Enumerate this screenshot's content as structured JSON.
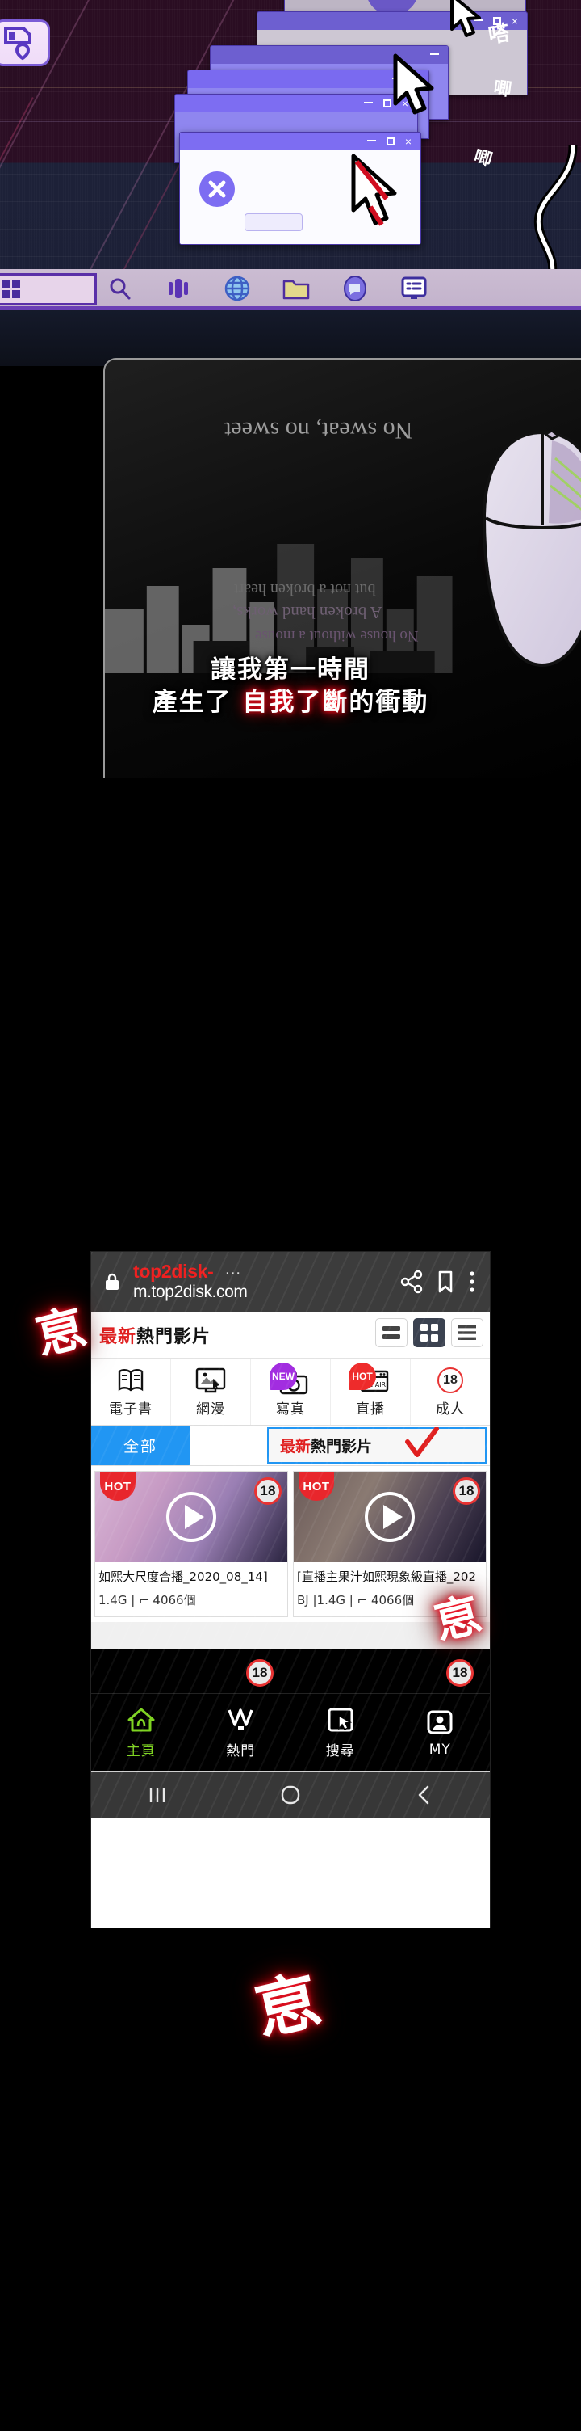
{
  "desktop": {
    "dialogs": [
      {
        "name": "dialog-1",
        "min": "—",
        "max": "□",
        "close": "×"
      },
      {
        "name": "dialog-2",
        "min": "—",
        "max": "□",
        "close": "×"
      },
      {
        "name": "dialog-3",
        "min": "—",
        "max": "□",
        "close": "×"
      },
      {
        "name": "dialog-4",
        "min": "—",
        "max": "□",
        "close": "×"
      },
      {
        "name": "dialog-5",
        "min": "—",
        "max": "□",
        "close": "×"
      }
    ],
    "error_dialog": {
      "icon": "error-x-icon",
      "minimize": "—",
      "maximize": "□",
      "close": "×",
      "button_label": ""
    },
    "taskbar": {
      "start_label": "",
      "icons": [
        "search-icon",
        "apps-icon",
        "globe-icon",
        "folder-icon",
        "chat-icon",
        "list-icon"
      ]
    },
    "badge_icon": "bookmark-heart-icon"
  },
  "desk_panel": {
    "mousepad_title": "No sweat, no sweet",
    "mousepad_lines": [
      "but not a broken heart",
      "A broken hand works,",
      "No house without a mouse"
    ]
  },
  "caption": {
    "line1": "讓我第一時間",
    "line2_a": "產生了 ",
    "line2_red": "自我了斷",
    "line2_b": "的衝動"
  },
  "phone": {
    "browser": {
      "lock_icon": "lock-icon",
      "title": "top2disk-",
      "dots": "···",
      "url": "m.top2disk.com",
      "share_icon": "share-icon",
      "bookmark_icon": "bookmark-icon",
      "menu_icon": "overflow-menu-icon"
    },
    "page_header": {
      "title_red": "最新",
      "title_rest": "熱門影片",
      "view_buttons": [
        "list-view-icon",
        "grid-view-icon",
        "menu-view-icon"
      ],
      "active_view": 1
    },
    "categories": [
      {
        "label": "電子書",
        "icon": "ebook-icon",
        "badge": ""
      },
      {
        "label": "網漫",
        "icon": "webtoon-icon",
        "badge": ""
      },
      {
        "label": "寫真",
        "icon": "camera-icon",
        "badge": "NEW"
      },
      {
        "label": "直播",
        "icon": "onair-icon",
        "badge": "HOT"
      },
      {
        "label": "成人",
        "icon": "adult-18-icon",
        "badge": "18"
      }
    ],
    "tabs": {
      "all_label": "全部",
      "selected_red": "最新",
      "selected_rest": "熱門影片",
      "check_icon": "red-check-icon"
    },
    "cards": [
      {
        "badge": "HOT",
        "rating": "18",
        "play_icon": "play-icon",
        "title": "如熙大尺度合播_2020_08_14]",
        "meta": "1.4G | ⌐ 4066個"
      },
      {
        "badge": "HOT",
        "rating": "18",
        "play_icon": "play-icon",
        "title": "[直播主果汁如熙現象級直播_202",
        "meta": "BJ  |1.4G | ⌐ 4066個"
      }
    ],
    "bottom_nav": [
      {
        "label": "主頁",
        "icon": "home-icon",
        "active": true
      },
      {
        "label": "熱門",
        "icon": "hot-v-icon",
        "active": false
      },
      {
        "label": "搜尋",
        "icon": "search-cursor-icon",
        "active": false
      },
      {
        "label": "MY",
        "icon": "profile-icon",
        "active": false
      }
    ],
    "floating_ratings": [
      "18",
      "18"
    ],
    "android_nav": [
      "recents-icon",
      "home-circle-icon",
      "back-icon"
    ]
  },
  "sfx": {
    "beat_1": "恴",
    "beat_2": "恴",
    "beat_3": "恴",
    "small_1": "嗒",
    "small_2": "唧",
    "small_3": "唧"
  },
  "colors": {
    "accent_purple": "#7d6df2",
    "sfx_red": "#ff1a2e",
    "brand_red": "#e01f1f",
    "active_green": "#7ed321",
    "tab_blue": "#2196f3"
  }
}
